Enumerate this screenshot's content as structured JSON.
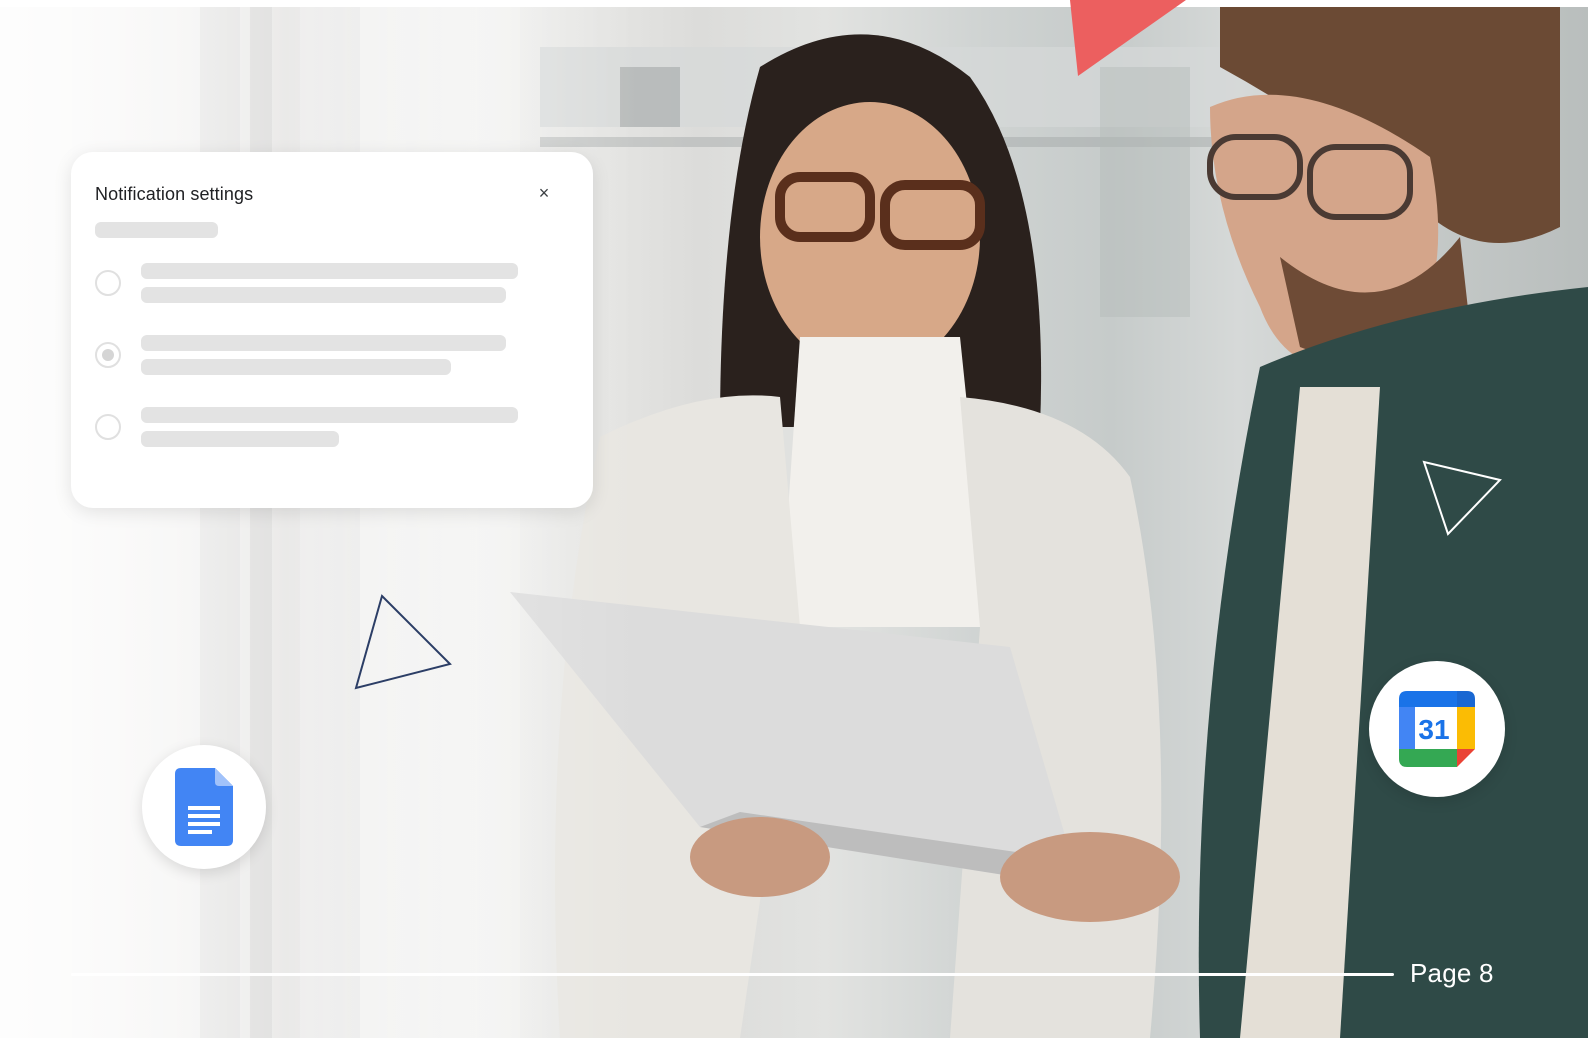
{
  "dialog": {
    "title": "Notification settings",
    "close_label": "×"
  },
  "radio_options": [
    {
      "selected": false
    },
    {
      "selected": true
    },
    {
      "selected": false
    }
  ],
  "icons": {
    "close": "close-icon",
    "docs": "google-docs-icon",
    "calendar": "google-calendar-icon"
  },
  "calendar_badge": {
    "day": "31"
  },
  "footer": {
    "page_label": "Page 8"
  },
  "colors": {
    "accent_coral": "#ec5f5f",
    "outline_navy": "#2c3e66",
    "docs_blue": "#4285f4",
    "calendar_blue": "#1a73e8",
    "calendar_green": "#34a853",
    "calendar_yellow": "#fbbc04",
    "calendar_red": "#ea4335"
  }
}
